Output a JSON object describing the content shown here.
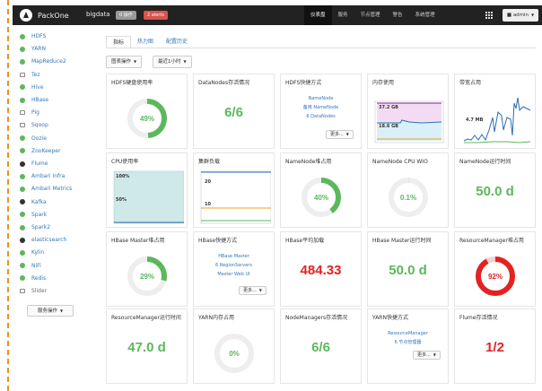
{
  "navbar": {
    "brand": "PackOne",
    "cluster": "bigdata",
    "ops_badge": "0 操作 ",
    "alerts_badge": "2 alerts",
    "items": [
      {
        "label": "仪表盘",
        "active": true
      },
      {
        "label": "服务",
        "active": false
      },
      {
        "label": "节点管理",
        "active": false
      },
      {
        "label": "警告",
        "active": false
      },
      {
        "label": "系统管理",
        "active": false
      }
    ],
    "user": "admin"
  },
  "sidebar": {
    "items": [
      {
        "label": "HDFS",
        "icon": "green-dot",
        "muted": false
      },
      {
        "label": "YARN",
        "icon": "green-dot",
        "muted": false
      },
      {
        "label": "MapReduce2",
        "icon": "green-dot",
        "muted": false
      },
      {
        "label": "Tez",
        "icon": "monitor",
        "muted": false
      },
      {
        "label": "Hive",
        "icon": "green-dot",
        "muted": false
      },
      {
        "label": "HBase",
        "icon": "green-dot",
        "muted": false
      },
      {
        "label": "Pig",
        "icon": "monitor",
        "muted": false
      },
      {
        "label": "Sqoop",
        "icon": "monitor",
        "muted": false
      },
      {
        "label": "Oozie",
        "icon": "green-dot",
        "muted": false
      },
      {
        "label": "ZooKeeper",
        "icon": "green-dot",
        "muted": false
      },
      {
        "label": "Flume",
        "icon": "dark-camera",
        "muted": false
      },
      {
        "label": "Ambari Infra",
        "icon": "green-dot",
        "muted": false
      },
      {
        "label": "Ambari Metrics",
        "icon": "green-dot",
        "muted": false
      },
      {
        "label": "Kafka",
        "icon": "dark-camera",
        "muted": false
      },
      {
        "label": "Spark",
        "icon": "green-dot",
        "muted": false
      },
      {
        "label": "Spark2",
        "icon": "green-dot",
        "muted": false
      },
      {
        "label": "elasticsearch",
        "icon": "dark-camera",
        "muted": false
      },
      {
        "label": "Kylin",
        "icon": "green-dot",
        "muted": false
      },
      {
        "label": "NiFi",
        "icon": "green-dot",
        "muted": false
      },
      {
        "label": "Redis",
        "icon": "green-dot",
        "muted": false
      },
      {
        "label": "Slider",
        "icon": "monitor",
        "muted": true
      }
    ],
    "actions_button": "服务操作"
  },
  "tabs": [
    {
      "label": "指标",
      "active": true
    },
    {
      "label": "热力图",
      "active": false
    },
    {
      "label": "配置历史",
      "active": false
    }
  ],
  "toolbar": {
    "service_actions": "图表操作",
    "time_range": "最近1小时"
  },
  "widgets": {
    "hdfs_disk": {
      "title": "HDFS硬盘使用率",
      "value": "49%",
      "fraction": 0.49
    },
    "datanodes": {
      "title": "DataNodes存活情况",
      "value": "6/6"
    },
    "hdfs_links": {
      "title": "HDFS快捷方式",
      "links": [
        "NameNode",
        "备用 NameNode",
        "6 DataNodes"
      ],
      "more": "更多..."
    },
    "memory": {
      "title": "内存使用",
      "label_top": "37.2 GB",
      "label_bottom": "18.6 GB"
    },
    "network": {
      "title": "带宽占用",
      "label": "4.7 MB"
    },
    "cpu": {
      "title": "CPU使用率",
      "label_top": "100%",
      "label_mid": "50%"
    },
    "cluster_load": {
      "title": "集群负载",
      "label_top": "20",
      "label_mid": "10"
    },
    "namenode_heap": {
      "title": "NameNode堆占用",
      "value": "40%",
      "fraction": 0.4
    },
    "namenode_cpu": {
      "title": "NameNode CPU WIO",
      "value": "0.1%",
      "fraction": 0.001
    },
    "namenode_uptime": {
      "title": "NameNode运行时间",
      "value": "50.0 d"
    },
    "hbase_master_heap": {
      "title": "HBase Master堆占用",
      "value": "29%",
      "fraction": 0.29
    },
    "hbase_links": {
      "title": "HBase快捷方式",
      "links": [
        "HBase Master",
        "6 RegionServers",
        "Master Web UI"
      ],
      "more": "更多..."
    },
    "hbase_load": {
      "title": "HBase平均加载",
      "value": "484.33"
    },
    "hbase_uptime": {
      "title": "HBase Master运行时间",
      "value": "50.0 d"
    },
    "rm_heap": {
      "title": "ResourceManager堆占用",
      "value": "92%",
      "fraction": 0.92
    },
    "rm_uptime": {
      "title": "ResourceManager运行时间",
      "value": "47.0 d"
    },
    "yarn_memory": {
      "title": "YARN内存占用",
      "value": "0%",
      "fraction": 0.0
    },
    "nodemanagers": {
      "title": "NodeManagers存活情况",
      "value": "6/6"
    },
    "yarn_links": {
      "title": "YARN快捷方式",
      "links": [
        "ResourceManager",
        "6 节点管理器"
      ],
      "more": "更多..."
    },
    "flume": {
      "title": "Flume存活情况",
      "value": "1/2"
    }
  },
  "colors": {
    "ok": "#5cb85c",
    "critical": "#e32222",
    "link": "#337ab7",
    "navbar": "#222222"
  }
}
